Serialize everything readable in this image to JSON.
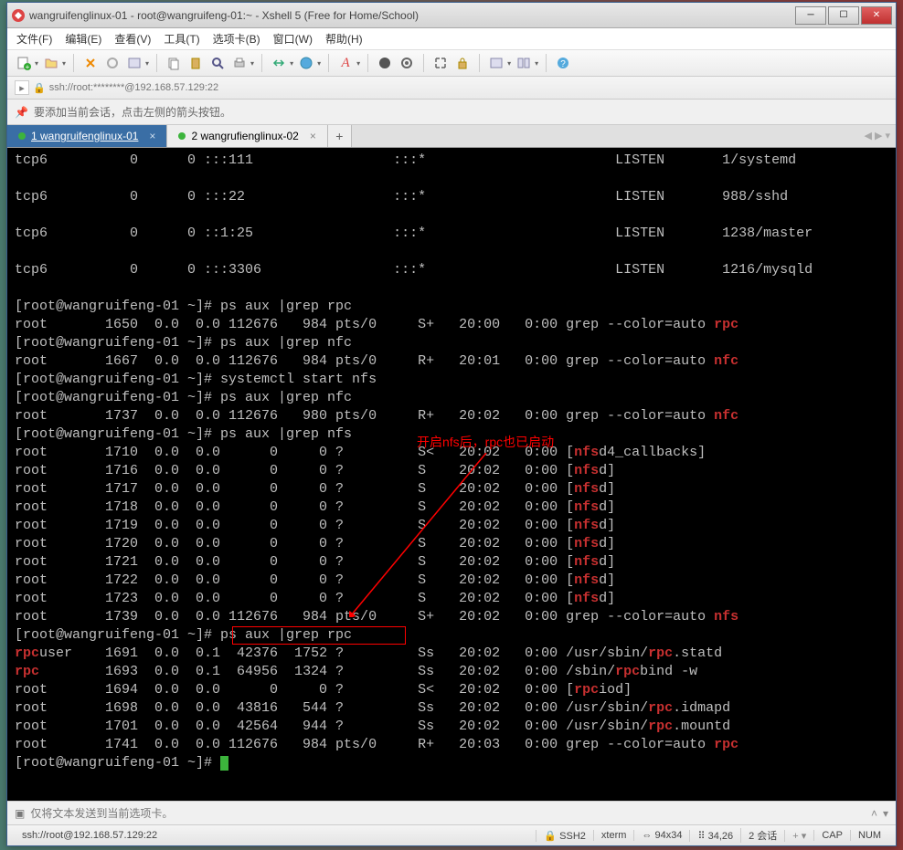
{
  "window": {
    "title": "wangruifenglinux-01 - root@wangruifeng-01:~ - Xshell 5 (Free for Home/School)"
  },
  "menu": {
    "file": "文件(F)",
    "edit": "编辑(E)",
    "view": "查看(V)",
    "tools": "工具(T)",
    "tabs": "选项卡(B)",
    "window": "窗口(W)",
    "help": "帮助(H)"
  },
  "addressbar": {
    "text": "ssh://root:********@192.168.57.129:22"
  },
  "hint": {
    "text": "要添加当前会话，点击左侧的箭头按钮。"
  },
  "tabs": [
    {
      "label": "1 wangruifenglinux-01",
      "active": true
    },
    {
      "label": "2 wangrufienglinux-02",
      "active": false
    }
  ],
  "terminal": {
    "netstat": [
      {
        "proto": "tcp6",
        "recv": "0",
        "send": "0",
        "local": ":::111",
        "remote": ":::*",
        "state": "LISTEN",
        "pid": "1/systemd"
      },
      {
        "proto": "tcp6",
        "recv": "0",
        "send": "0",
        "local": ":::22",
        "remote": ":::*",
        "state": "LISTEN",
        "pid": "988/sshd"
      },
      {
        "proto": "tcp6",
        "recv": "0",
        "send": "0",
        "local": "::1:25",
        "remote": ":::*",
        "state": "LISTEN",
        "pid": "1238/master"
      },
      {
        "proto": "tcp6",
        "recv": "0",
        "send": "0",
        "local": ":::3306",
        "remote": ":::*",
        "state": "LISTEN",
        "pid": "1216/mysqld"
      }
    ],
    "prompt": "[root@wangruifeng-01 ~]# ",
    "cmd1": "ps aux |grep rpc",
    "ps1": [
      {
        "user": "root",
        "pid": "1650",
        "cpu": "0.0",
        "mem": "0.0",
        "vsz": "112676",
        "rss": "984",
        "tty": "pts/0",
        "stat": "S+",
        "time": "20:00",
        "dur": "0:00",
        "cmd_pre": "grep --color=auto ",
        "hl": "rpc",
        "cmd_post": ""
      }
    ],
    "cmd2": "ps aux |grep nfc",
    "ps2": [
      {
        "user": "root",
        "pid": "1667",
        "cpu": "0.0",
        "mem": "0.0",
        "vsz": "112676",
        "rss": "984",
        "tty": "pts/0",
        "stat": "R+",
        "time": "20:01",
        "dur": "0:00",
        "cmd_pre": "grep --color=auto ",
        "hl": "nfc",
        "cmd_post": ""
      }
    ],
    "cmd3": "systemctl start nfs",
    "cmd4": "ps aux |grep nfc",
    "ps4": [
      {
        "user": "root",
        "pid": "1737",
        "cpu": "0.0",
        "mem": "0.0",
        "vsz": "112676",
        "rss": "980",
        "tty": "pts/0",
        "stat": "R+",
        "time": "20:02",
        "dur": "0:00",
        "cmd_pre": "grep --color=auto ",
        "hl": "nfc",
        "cmd_post": ""
      }
    ],
    "cmd5": "ps aux |grep nfs",
    "ps5": [
      {
        "user": "root",
        "pid": "1710",
        "cpu": "0.0",
        "mem": "0.0",
        "vsz": "0",
        "rss": "0",
        "tty": "?",
        "stat": "S<",
        "time": "20:02",
        "dur": "0:00",
        "cmd_pre": "[",
        "hl": "nfs",
        "cmd_post": "d4_callbacks]"
      },
      {
        "user": "root",
        "pid": "1716",
        "cpu": "0.0",
        "mem": "0.0",
        "vsz": "0",
        "rss": "0",
        "tty": "?",
        "stat": "S",
        "time": "20:02",
        "dur": "0:00",
        "cmd_pre": "[",
        "hl": "nfs",
        "cmd_post": "d]"
      },
      {
        "user": "root",
        "pid": "1717",
        "cpu": "0.0",
        "mem": "0.0",
        "vsz": "0",
        "rss": "0",
        "tty": "?",
        "stat": "S",
        "time": "20:02",
        "dur": "0:00",
        "cmd_pre": "[",
        "hl": "nfs",
        "cmd_post": "d]"
      },
      {
        "user": "root",
        "pid": "1718",
        "cpu": "0.0",
        "mem": "0.0",
        "vsz": "0",
        "rss": "0",
        "tty": "?",
        "stat": "S",
        "time": "20:02",
        "dur": "0:00",
        "cmd_pre": "[",
        "hl": "nfs",
        "cmd_post": "d]"
      },
      {
        "user": "root",
        "pid": "1719",
        "cpu": "0.0",
        "mem": "0.0",
        "vsz": "0",
        "rss": "0",
        "tty": "?",
        "stat": "S",
        "time": "20:02",
        "dur": "0:00",
        "cmd_pre": "[",
        "hl": "nfs",
        "cmd_post": "d]"
      },
      {
        "user": "root",
        "pid": "1720",
        "cpu": "0.0",
        "mem": "0.0",
        "vsz": "0",
        "rss": "0",
        "tty": "?",
        "stat": "S",
        "time": "20:02",
        "dur": "0:00",
        "cmd_pre": "[",
        "hl": "nfs",
        "cmd_post": "d]"
      },
      {
        "user": "root",
        "pid": "1721",
        "cpu": "0.0",
        "mem": "0.0",
        "vsz": "0",
        "rss": "0",
        "tty": "?",
        "stat": "S",
        "time": "20:02",
        "dur": "0:00",
        "cmd_pre": "[",
        "hl": "nfs",
        "cmd_post": "d]"
      },
      {
        "user": "root",
        "pid": "1722",
        "cpu": "0.0",
        "mem": "0.0",
        "vsz": "0",
        "rss": "0",
        "tty": "?",
        "stat": "S",
        "time": "20:02",
        "dur": "0:00",
        "cmd_pre": "[",
        "hl": "nfs",
        "cmd_post": "d]"
      },
      {
        "user": "root",
        "pid": "1723",
        "cpu": "0.0",
        "mem": "0.0",
        "vsz": "0",
        "rss": "0",
        "tty": "?",
        "stat": "S",
        "time": "20:02",
        "dur": "0:00",
        "cmd_pre": "[",
        "hl": "nfs",
        "cmd_post": "d]"
      },
      {
        "user": "root",
        "pid": "1739",
        "cpu": "0.0",
        "mem": "0.0",
        "vsz": "112676",
        "rss": "984",
        "tty": "pts/0",
        "stat": "S+",
        "time": "20:02",
        "dur": "0:00",
        "cmd_pre": "grep --color=auto ",
        "hl": "nfs",
        "cmd_post": ""
      }
    ],
    "cmd6": "ps aux |grep rpc",
    "ps6": [
      {
        "user_pre": "",
        "hl_user": "rpc",
        "user_post": "user",
        "pid": "1691",
        "cpu": "0.0",
        "mem": "0.1",
        "vsz": "42376",
        "rss": "1752",
        "tty": "?",
        "stat": "Ss",
        "time": "20:02",
        "dur": "0:00",
        "cmd_pre": "/usr/sbin/",
        "hl": "rpc",
        "cmd_post": ".statd"
      },
      {
        "user_pre": "",
        "hl_user": "rpc",
        "user_post": "",
        "pid": "1693",
        "cpu": "0.0",
        "mem": "0.1",
        "vsz": "64956",
        "rss": "1324",
        "tty": "?",
        "stat": "Ss",
        "time": "20:02",
        "dur": "0:00",
        "cmd_pre": "/sbin/",
        "hl": "rpc",
        "cmd_post": "bind -w"
      },
      {
        "user_pre": "root",
        "hl_user": "",
        "user_post": "",
        "pid": "1694",
        "cpu": "0.0",
        "mem": "0.0",
        "vsz": "0",
        "rss": "0",
        "tty": "?",
        "stat": "S<",
        "time": "20:02",
        "dur": "0:00",
        "cmd_pre": "[",
        "hl": "rpc",
        "cmd_post": "iod]"
      },
      {
        "user_pre": "root",
        "hl_user": "",
        "user_post": "",
        "pid": "1698",
        "cpu": "0.0",
        "mem": "0.0",
        "vsz": "43816",
        "rss": "544",
        "tty": "?",
        "stat": "Ss",
        "time": "20:02",
        "dur": "0:00",
        "cmd_pre": "/usr/sbin/",
        "hl": "rpc",
        "cmd_post": ".idmapd"
      },
      {
        "user_pre": "root",
        "hl_user": "",
        "user_post": "",
        "pid": "1701",
        "cpu": "0.0",
        "mem": "0.0",
        "vsz": "42564",
        "rss": "944",
        "tty": "?",
        "stat": "Ss",
        "time": "20:02",
        "dur": "0:00",
        "cmd_pre": "/usr/sbin/",
        "hl": "rpc",
        "cmd_post": ".mountd"
      },
      {
        "user_pre": "root",
        "hl_user": "",
        "user_post": "",
        "pid": "1741",
        "cpu": "0.0",
        "mem": "0.0",
        "vsz": "112676",
        "rss": "984",
        "tty": "pts/0",
        "stat": "R+",
        "time": "20:03",
        "dur": "0:00",
        "cmd_pre": "grep --color=auto ",
        "hl": "rpc",
        "cmd_post": ""
      }
    ],
    "annotation": "开启nfs后，rpc也已启动"
  },
  "bottombar": {
    "text": "仅将文本发送到当前选项卡。"
  },
  "statusbar": {
    "conn": "ssh://root@192.168.57.129:22",
    "ssh": "SSH2",
    "term": "xterm",
    "size": "94x34",
    "pos": "34,26",
    "sessions": "2 会话",
    "cap": "CAP",
    "num": "NUM"
  }
}
